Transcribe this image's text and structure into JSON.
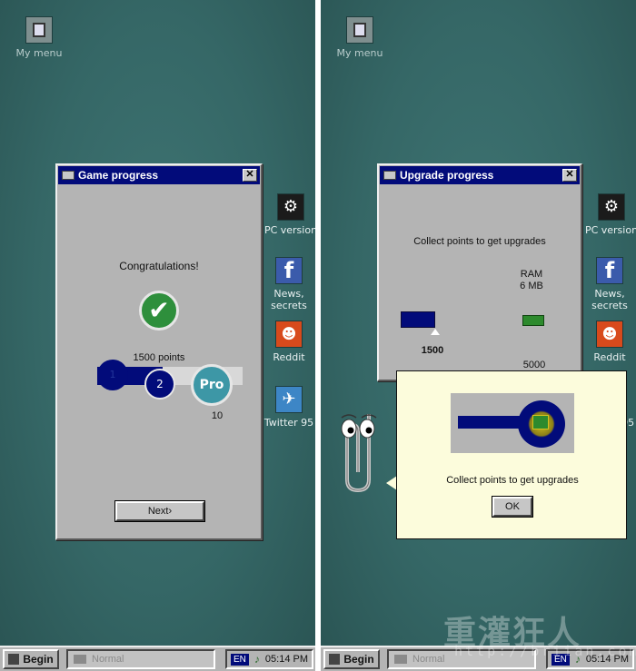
{
  "desktop": {
    "my_menu": "My menu",
    "icons": {
      "pc_version": "PC version",
      "news": "News,\nsecrets",
      "reddit": "Reddit",
      "twitter": "Twitter 95"
    }
  },
  "game_progress_window": {
    "title": "Game progress",
    "close": "✕",
    "message": "Congratulations!",
    "points_text": "1500 points",
    "steps": [
      "1",
      "2",
      "Pro"
    ],
    "pro_count": "10",
    "progress_fraction": 0.45,
    "next_button": "Next›"
  },
  "upgrade_progress_window": {
    "title": "Upgrade progress",
    "close": "✕",
    "message": "Collect points to get upgrades",
    "ram_label": "RAM\n6 MB",
    "current_points": "1500",
    "target_points": "5000"
  },
  "tooltip": {
    "text": "Collect points to get upgrades",
    "ok_button": "OK"
  },
  "taskbar": {
    "begin": "Begin",
    "task": "Normal",
    "lang": "EN",
    "time": "05:14 PM"
  },
  "watermark": {
    "text": "重灌狂人",
    "url": "http://briian.com"
  },
  "colors": {
    "desktop": "#356766",
    "titlebar": "#020b7a",
    "window": "#b4b4b4",
    "tooltip": "#fcfcdc",
    "check": "#2e8f3c",
    "pro": "#3d97a6"
  }
}
